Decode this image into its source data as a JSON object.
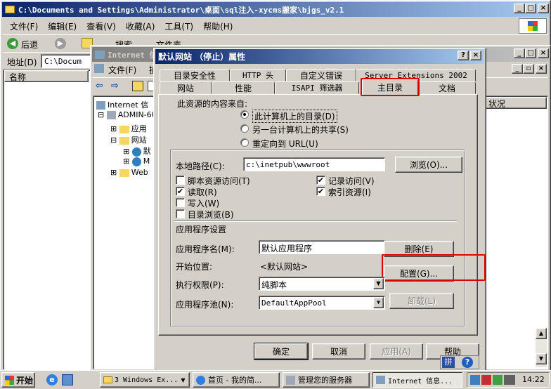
{
  "explorer": {
    "title": "C:\\Documents and Settings\\Administrator\\桌面\\sql注入-xycms搬家\\bjgs_v2.1",
    "menu": [
      "文件(F)",
      "编辑(E)",
      "查看(V)",
      "收藏(A)",
      "工具(T)",
      "帮助(H)"
    ],
    "back_label": "后退",
    "search_label": "搜索",
    "folders_label": "文件夹",
    "address_label": "地址(D)",
    "address_value": "C:\\Docum",
    "col_name": "名称",
    "col_status": "状况"
  },
  "iis": {
    "title": "Internet 信",
    "menu": [
      "文件(F)",
      "操"
    ],
    "tree": [
      "Internet 信",
      "ADMIN-60",
      "应用",
      "网站",
      "默",
      "M",
      "Web"
    ]
  },
  "dialog": {
    "title": "默认网站 （停止）属性",
    "tabs_back": [
      "目录安全性",
      "HTTP 头",
      "自定义错误",
      "Server Extensions 2002"
    ],
    "tabs_front": [
      "网站",
      "性能",
      "ISAPI 筛选器",
      "主目录",
      "文档"
    ],
    "source_label": "此资源的内容来自:",
    "radios": [
      "此计算机上的目录(D)",
      "另一台计算机上的共享(S)",
      "重定向到 URL(U)"
    ],
    "local_path_label": "本地路径(C):",
    "local_path_value": "c:\\inetpub\\wwwroot",
    "browse_btn": "浏览(O)...",
    "checks_left": [
      "脚本资源访问(T)",
      "读取(R)",
      "写入(W)",
      "目录浏览(B)"
    ],
    "checks_right": [
      "记录访问(V)",
      "索引资源(I)"
    ],
    "app_settings_label": "应用程序设置",
    "app_name_label": "应用程序名(M):",
    "app_name_value": "默认应用程序",
    "remove_btn": "删除(E)",
    "start_label": "开始位置:",
    "start_value": "<默认网站>",
    "config_btn": "配置(G)...",
    "exec_label": "执行权限(P):",
    "exec_value": "纯脚本",
    "pool_label": "应用程序池(N):",
    "pool_value": "DefaultAppPool",
    "unload_btn": "卸载(L)",
    "ok_btn": "确定",
    "cancel_btn": "取消",
    "apply_btn": "应用(A)",
    "help_btn": "帮助"
  },
  "taskbar": {
    "start": "开始",
    "items": [
      "3 Windows Ex...",
      "首页 - 我的简...",
      "管理您的服务器",
      "Internet 信息..."
    ],
    "ime": "拼",
    "clock": "14:22"
  }
}
